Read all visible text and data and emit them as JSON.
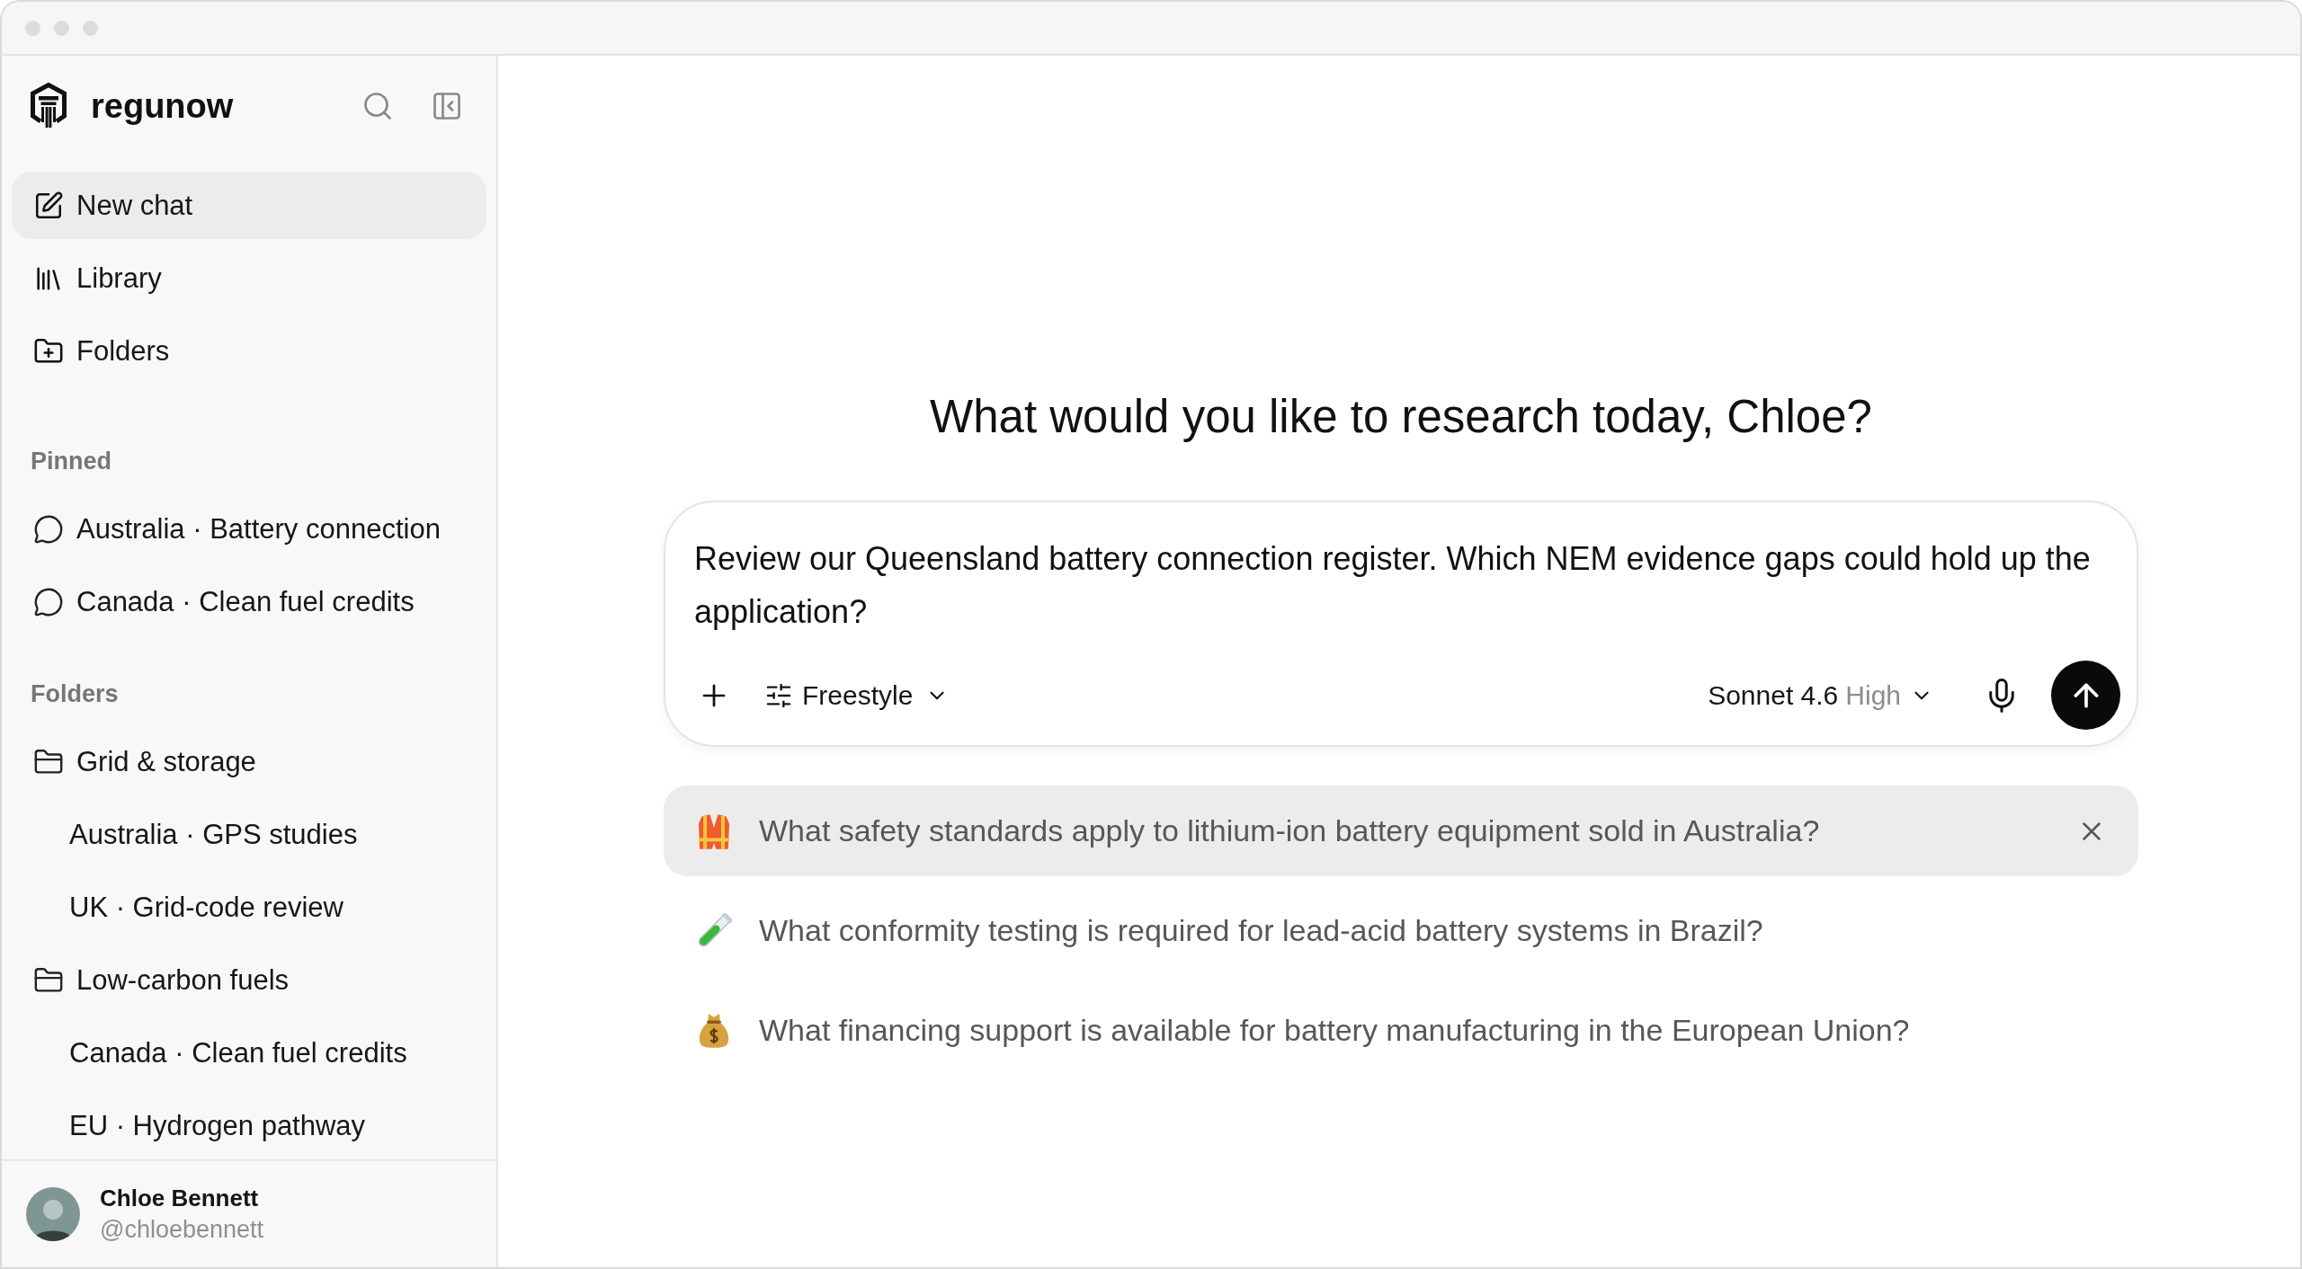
{
  "sidebar": {
    "brand": "regunow",
    "nav": [
      {
        "label": "New chat",
        "selected": true
      },
      {
        "label": "Library",
        "selected": false
      },
      {
        "label": "Folders",
        "selected": false
      }
    ],
    "pinned": {
      "heading": "Pinned",
      "items": [
        {
          "label": "Australia · Battery connection"
        },
        {
          "label": "Canada · Clean fuel credits"
        }
      ]
    },
    "folders": {
      "heading": "Folders",
      "items": [
        {
          "label": "Grid & storage",
          "children": [
            {
              "label": "Australia · GPS studies"
            },
            {
              "label": "UK · Grid-code review"
            }
          ]
        },
        {
          "label": "Low-carbon fuels",
          "children": [
            {
              "label": "Canada · Clean fuel credits"
            },
            {
              "label": "EU · Hydrogen pathway"
            }
          ]
        }
      ]
    },
    "user": {
      "name": "Chloe Bennett",
      "handle": "@chloebennett"
    }
  },
  "main": {
    "greeting": "What would you like to research today, Chloe?",
    "composer": {
      "value": "Review our Queensland battery connection register. Which NEM evidence gaps could hold up the application?",
      "mode": "Freestyle",
      "model": "Sonnet 4.6",
      "effort": "High"
    },
    "suggestions": [
      {
        "text": "What safety standards apply to lithium-ion battery equipment sold in Australia?",
        "selected": true
      },
      {
        "text": "What conformity testing is required for lead-acid battery systems in Brazil?",
        "selected": false
      },
      {
        "text": "What financing support is available for battery manufacturing in the European Union?",
        "selected": false
      }
    ]
  }
}
